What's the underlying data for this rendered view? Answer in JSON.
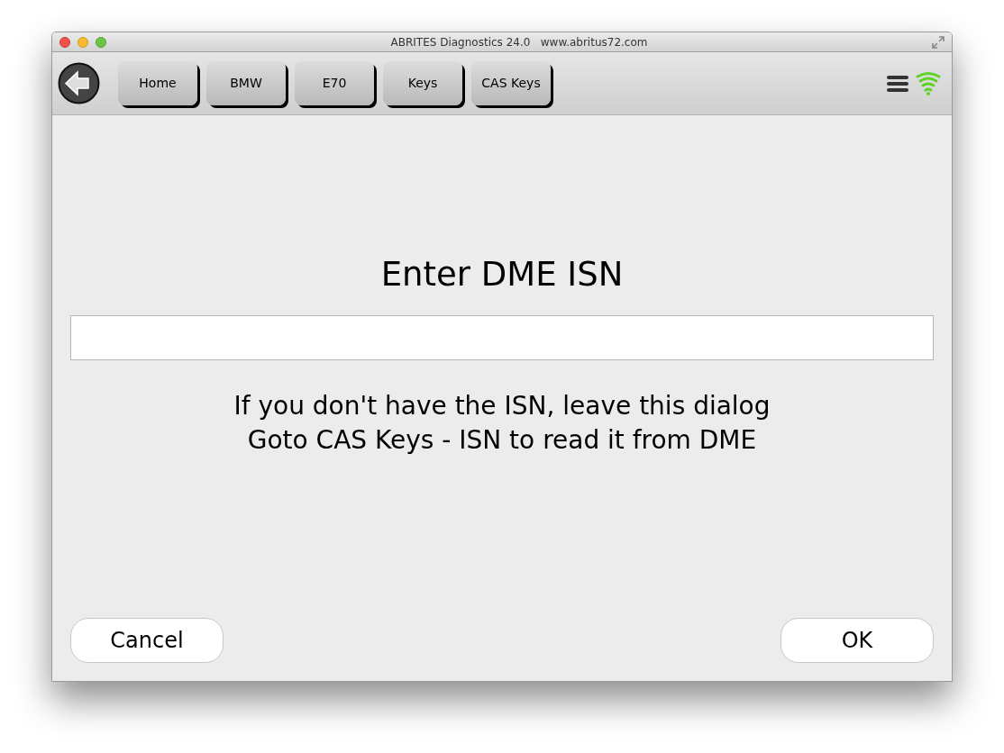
{
  "window": {
    "title": "ABRITES Diagnostics 24.0   www.abritus72.com"
  },
  "breadcrumbs": [
    {
      "label": "Home"
    },
    {
      "label": "BMW"
    },
    {
      "label": "E70"
    },
    {
      "label": "Keys"
    },
    {
      "label": "CAS Keys"
    }
  ],
  "dialog": {
    "heading": "Enter DME ISN",
    "message_lines": [
      "If you don't have the ISN, leave this dialog",
      "Goto CAS Keys - ISN to read it from DME"
    ]
  },
  "buttons": [
    {
      "label": "Cancel"
    },
    {
      "label": "OK"
    }
  ]
}
